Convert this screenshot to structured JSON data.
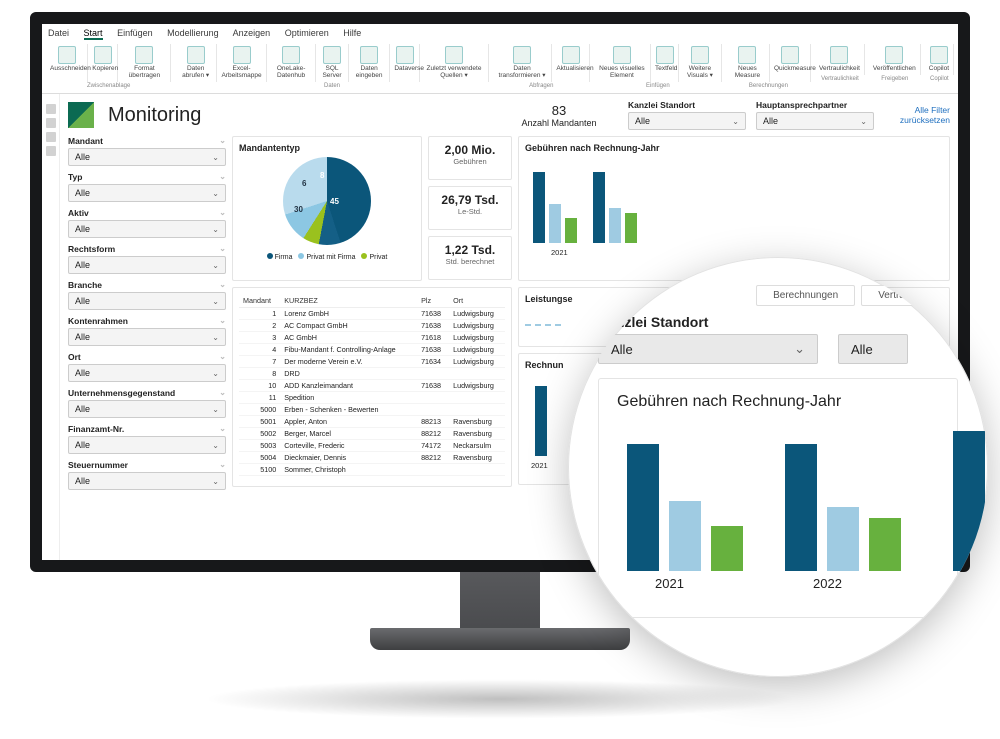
{
  "menubar": {
    "items": [
      "Datei",
      "Start",
      "Einfügen",
      "Modellierung",
      "Anzeigen",
      "Optimieren",
      "Hilfe"
    ],
    "active_index": 1
  },
  "ribbon": [
    {
      "group": "Zwischenablage",
      "items": [
        {
          "label": "Ausschneiden"
        },
        {
          "label": "Kopieren"
        },
        {
          "label": "Format übertragen"
        }
      ]
    },
    {
      "group": "Daten",
      "items": [
        {
          "label": "Daten abrufen ▾"
        },
        {
          "label": "Excel-Arbeitsmappe"
        },
        {
          "label": "OneLake-Datenhub"
        },
        {
          "label": "SQL Server"
        },
        {
          "label": "Daten eingeben"
        },
        {
          "label": "Dataverse"
        },
        {
          "label": "Zuletzt verwendete Quellen ▾"
        }
      ]
    },
    {
      "group": "Abfragen",
      "items": [
        {
          "label": "Daten transformieren ▾"
        },
        {
          "label": "Aktualisieren"
        }
      ]
    },
    {
      "group": "Einfügen",
      "items": [
        {
          "label": "Neues visuelles Element"
        },
        {
          "label": "Textfeld"
        },
        {
          "label": "Weitere Visuals ▾"
        }
      ]
    },
    {
      "group": "Berechnungen",
      "items": [
        {
          "label": "Neues Measure"
        },
        {
          "label": "Quickmeasure"
        }
      ]
    },
    {
      "group": "Vertraulichkeit",
      "items": [
        {
          "label": "Vertraulichkeit"
        }
      ]
    },
    {
      "group": "Freigeben",
      "items": [
        {
          "label": "Veröffentlichen"
        }
      ]
    },
    {
      "group": "Copilot",
      "items": [
        {
          "label": "Copilot"
        }
      ]
    }
  ],
  "dashboard": {
    "title": "Monitoring",
    "kpi_header": {
      "value": "83",
      "label": "Anzahl Mandanten"
    },
    "top_filters": [
      {
        "label": "Kanzlei Standort",
        "value": "Alle"
      },
      {
        "label": "Hauptansprechpartner",
        "value": "Alle"
      }
    ],
    "top_link": "Alle Filter zurücksetzen"
  },
  "side_filters": [
    {
      "label": "Mandant",
      "value": "Alle"
    },
    {
      "label": "Typ",
      "value": "Alle"
    },
    {
      "label": "Aktiv",
      "value": "Alle"
    },
    {
      "label": "Rechtsform",
      "value": "Alle"
    },
    {
      "label": "Branche",
      "value": "Alle"
    },
    {
      "label": "Kontenrahmen",
      "value": "Alle"
    },
    {
      "label": "Ort",
      "value": "Alle"
    },
    {
      "label": "Unternehmensgegenstand",
      "value": "Alle"
    },
    {
      "label": "Finanzamt-Nr.",
      "value": "Alle"
    },
    {
      "label": "Steuernummer",
      "value": "Alle"
    }
  ],
  "mandantentyp": {
    "title": "Mandantentyp",
    "legend": [
      "Firma",
      "Privat mit Firma",
      "Privat"
    ],
    "labels": {
      "a": "45",
      "b": "8",
      "c": "6",
      "d": "30"
    }
  },
  "kpi_cards": [
    {
      "value": "2,00 Mio.",
      "label": "Gebühren"
    },
    {
      "value": "26,79 Tsd.",
      "label": "Le-Std."
    },
    {
      "value": "1,22 Tsd.",
      "label": "Std. berechnet"
    }
  ],
  "table": {
    "headers": [
      "Mandant",
      "KURZBEZ",
      "Plz",
      "Ort"
    ],
    "rows": [
      [
        "1",
        "Lorenz GmbH",
        "71638",
        "Ludwigsburg"
      ],
      [
        "2",
        "AC Compact GmbH",
        "71638",
        "Ludwigsburg"
      ],
      [
        "3",
        "AC GmbH",
        "71618",
        "Ludwigsburg"
      ],
      [
        "4",
        "Fibu-Mandant f. Controlling-Anlage",
        "71638",
        "Ludwigsburg"
      ],
      [
        "7",
        "Der moderne Verein e.V.",
        "71634",
        "Ludwigsburg"
      ],
      [
        "8",
        "DRD",
        "",
        ""
      ],
      [
        "10",
        "ADD Kanzleimandant",
        "71638",
        "Ludwigsburg"
      ],
      [
        "11",
        "Spedition",
        "",
        ""
      ],
      [
        "5000",
        "Erben - Schenken - Bewerten",
        "",
        ""
      ],
      [
        "5001",
        "Appler, Anton",
        "88213",
        "Ravensburg"
      ],
      [
        "5002",
        "Berger, Marcel",
        "88212",
        "Ravensburg"
      ],
      [
        "5003",
        "Corteville, Frederic",
        "74172",
        "Neckarsulm"
      ],
      [
        "5004",
        "Dieckmaier, Dennis",
        "88212",
        "Ravensburg"
      ],
      [
        "5100",
        "Sommer, Christoph",
        "",
        ""
      ]
    ]
  },
  "small_charts": {
    "title1": "Gebühren nach Rechnung-Jahr",
    "title2": "Leistungse",
    "title3": "Rechnun",
    "year_label": "2021"
  },
  "chart_data": {
    "type": "bar",
    "title": "Gebühren nach Rechnung-Jahr",
    "categories": [
      "2021",
      "2022"
    ],
    "series": [
      {
        "name": "Firma",
        "color": "#0b567a",
        "values": [
          100,
          100
        ]
      },
      {
        "name": "Privat mit Firma",
        "color": "#9fcbe2",
        "values": [
          55,
          50
        ]
      },
      {
        "name": "Privat",
        "color": "#67b13e",
        "values": [
          35,
          42
        ]
      }
    ],
    "ylim": [
      0,
      110
    ]
  },
  "magnifier": {
    "tabs": [
      "Berechnungen",
      "Vertraulichkeit"
    ],
    "filter_label": "Kanzlei Standort",
    "filter_value": "Alle",
    "filter_value2": "Alle",
    "chart_title": "Gebühren nach Rechnung-Jahr",
    "years": [
      "2021",
      "2022"
    ]
  }
}
